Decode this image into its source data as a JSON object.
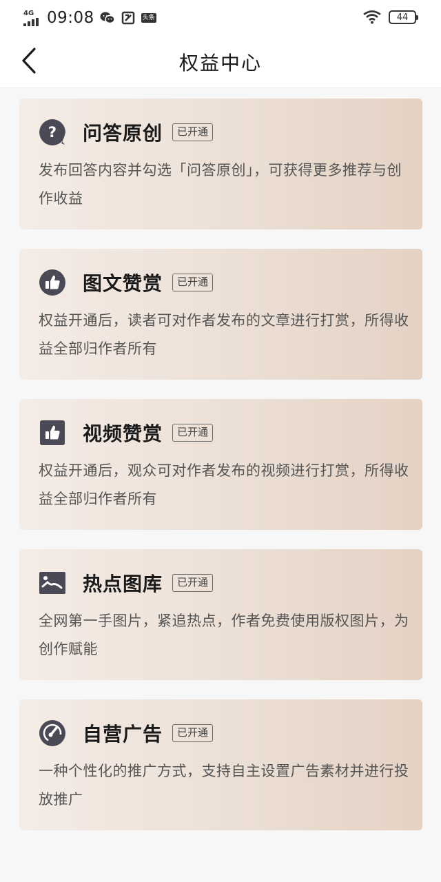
{
  "status_bar": {
    "network": "4G",
    "time": "09:08",
    "battery": "44",
    "left_icons": [
      "wechat-icon",
      "sim-icon",
      "toutiao-icon"
    ],
    "toutiao_text": "头条"
  },
  "nav": {
    "title": "权益中心"
  },
  "colors": {
    "icon": "#4a4a57",
    "card_start": "#f4ece6",
    "card_end": "#e4d2c4"
  },
  "cards": [
    {
      "icon": "question-icon",
      "title": "问答原创",
      "badge": "已开通",
      "desc": "发布回答内容并勾选「问答原创」，可获得更多推荐与创作收益"
    },
    {
      "icon": "thumbs-up-icon",
      "title": "图文赞赏",
      "badge": "已开通",
      "desc": "权益开通后，读者可对作者发布的文章进行打赏，所得收益全部归作者所有"
    },
    {
      "icon": "thumbs-up-square-icon",
      "title": "视频赞赏",
      "badge": "已开通",
      "desc": "权益开通后，观众可对作者发布的视频进行打赏，所得收益全部归作者所有"
    },
    {
      "icon": "image-icon",
      "title": "热点图库",
      "badge": "已开通",
      "desc": "全网第一手图片，紧追热点，作者免费使用版权图片，为创作赋能"
    },
    {
      "icon": "gauge-icon",
      "title": "自营广告",
      "badge": "已开通",
      "desc": "一种个性化的推广方式，支持自主设置广告素材并进行投放推广"
    }
  ]
}
